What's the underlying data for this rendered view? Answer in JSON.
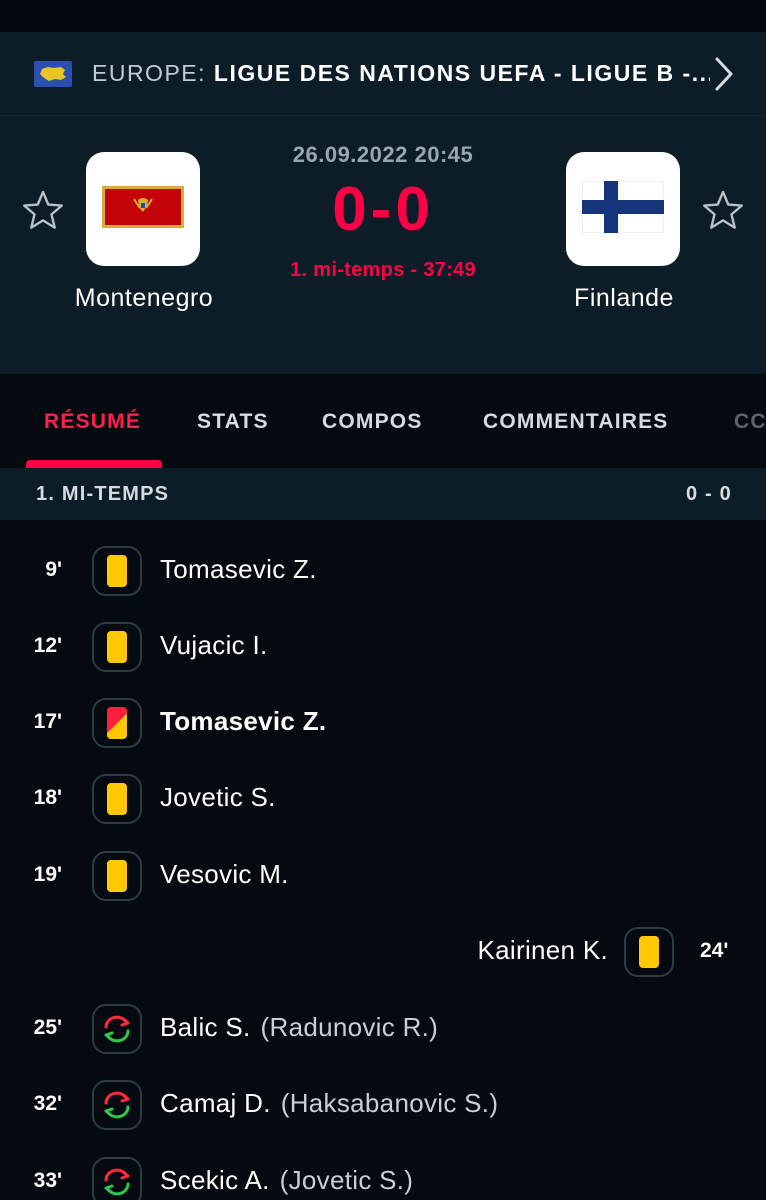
{
  "competition": {
    "country": "EUROPE:",
    "name": "LIGUE DES NATIONS UEFA - LIGUE B -...",
    "flag_icon": "europe-flag-icon"
  },
  "match": {
    "datetime": "26.09.2022 20:45",
    "score": "0-0",
    "status": "1. mi-temps - 37:49",
    "home": {
      "name": "Montenegro",
      "flag_icon": "montenegro-flag-icon"
    },
    "away": {
      "name": "Finlande",
      "flag_icon": "finland-flag-icon"
    }
  },
  "tabs": [
    {
      "label": "RÉSUMÉ",
      "active": true
    },
    {
      "label": "STATS",
      "active": false
    },
    {
      "label": "COMPOS",
      "active": false
    },
    {
      "label": "COMMENTAIRES",
      "active": false
    },
    {
      "label": "CC",
      "active": false
    }
  ],
  "section": {
    "title": "1. MI-TEMPS",
    "score": "0 - 0"
  },
  "events": [
    {
      "minute": "9'",
      "side": "home",
      "type": "yellow-card",
      "player": "Tomasevic Z.",
      "player_out": ""
    },
    {
      "minute": "12'",
      "side": "home",
      "type": "yellow-card",
      "player": "Vujacic I.",
      "player_out": ""
    },
    {
      "minute": "17'",
      "side": "home",
      "type": "second-yellow-red-card",
      "player": "Tomasevic Z.",
      "player_out": ""
    },
    {
      "minute": "18'",
      "side": "home",
      "type": "yellow-card",
      "player": "Jovetic S.",
      "player_out": ""
    },
    {
      "minute": "19'",
      "side": "home",
      "type": "yellow-card",
      "player": "Vesovic M.",
      "player_out": ""
    },
    {
      "minute": "24'",
      "side": "away",
      "type": "yellow-card",
      "player": "Kairinen K.",
      "player_out": ""
    },
    {
      "minute": "25'",
      "side": "home",
      "type": "substitution",
      "player": "Balic S.",
      "player_out": "(Radunovic R.)"
    },
    {
      "minute": "32'",
      "side": "home",
      "type": "substitution",
      "player": "Camaj D.",
      "player_out": "(Haksabanovic S.)"
    },
    {
      "minute": "33'",
      "side": "home",
      "type": "substitution",
      "player": "Scekic A.",
      "player_out": "(Jovetic S.)"
    }
  ],
  "colors": {
    "accent": "#ff0046",
    "panel": "#0d1d27",
    "background": "#050a10",
    "yellow_card": "#ffc800",
    "red_card": "#ff1f3d",
    "sub_in": "#2ec84a",
    "sub_out": "#ff2a3f"
  }
}
